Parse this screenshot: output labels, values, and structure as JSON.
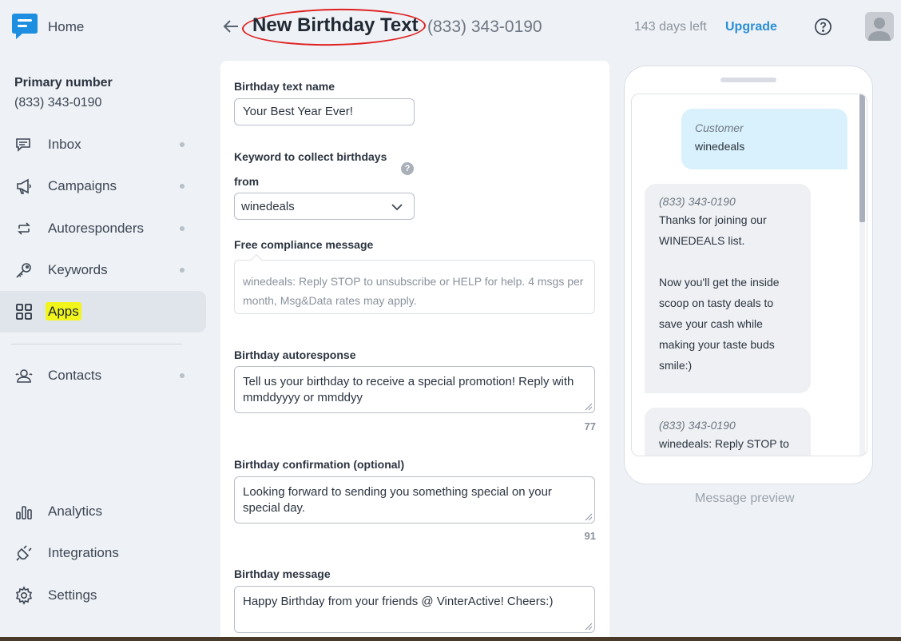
{
  "sidebar": {
    "home_label": "Home",
    "primary_title": "Primary number",
    "primary_number": "(833) 343-0190",
    "items": [
      {
        "label": "Inbox",
        "icon": "chat-icon"
      },
      {
        "label": "Campaigns",
        "icon": "megaphone-icon"
      },
      {
        "label": "Autoresponders",
        "icon": "refresh-icon"
      },
      {
        "label": "Keywords",
        "icon": "key-icon"
      },
      {
        "label": "Apps",
        "icon": "grid-icon"
      },
      {
        "label": "Contacts",
        "icon": "contacts-icon"
      },
      {
        "label": "Analytics",
        "icon": "bar-chart-icon"
      },
      {
        "label": "Integrations",
        "icon": "plug-icon"
      },
      {
        "label": "Settings",
        "icon": "gear-icon"
      }
    ]
  },
  "header": {
    "title": "New Birthday Text",
    "number": "(833) 343-0190",
    "days_left": "143 days left",
    "upgrade": "Upgrade"
  },
  "form": {
    "name_label": "Birthday text name",
    "name_value": "Your Best Year Ever!",
    "keyword_label_line1": "Keyword to collect birthdays",
    "keyword_label_line2": "from",
    "keyword_help": "?",
    "keyword_value": "winedeals",
    "compliance_label": "Free compliance message",
    "compliance_text": "winedeals: Reply STOP to unsubscribe or HELP for help. 4 msgs per month, Msg&Data rates may apply.",
    "autoresponse_label": "Birthday autoresponse",
    "autoresponse_value": "Tell us your birthday to receive a special promotion! Reply with mmddyyyy or mmddyy",
    "autoresponse_count": "77",
    "confirmation_label": "Birthday confirmation (optional)",
    "confirmation_value": "Looking forward to sending you something special on your special day.",
    "confirmation_count": "91",
    "message_label": "Birthday message",
    "message_value": "Happy Birthday from your friends @ VinterActive!  Cheers:)"
  },
  "preview": {
    "out_sender": "Customer",
    "out_text": "winedeals",
    "in1_sender": "(833) 343-0190",
    "in1_line1": "Thanks for joining our",
    "in1_line2": "WINEDEALS list.",
    "in1_line3": "Now you'll get the inside",
    "in1_line4": "scoop on tasty deals to",
    "in1_line5": "save your cash while",
    "in1_line6": "making your taste buds",
    "in1_line7": "smile:)",
    "in2_sender": "(833) 343-0190",
    "in2_text": "winedeals: Reply STOP to",
    "caption": "Message preview"
  },
  "colors": {
    "accent": "#2b8fd6",
    "highlight": "#f1f51b",
    "annotation": "#e02020",
    "bubble_out": "#d8f1fc",
    "bubble_in": "#eef0f3"
  }
}
